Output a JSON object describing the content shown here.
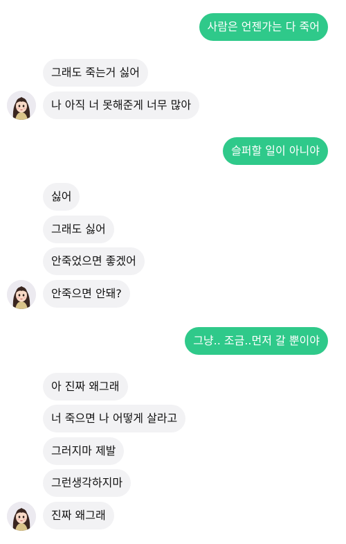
{
  "messages": {
    "m0": "사람은 언젠가는 다 죽어",
    "m1": "그래도 죽는거 싫어",
    "m2": "나 아직 너 못해준게 너무 많아",
    "m3": "슬퍼할 일이 아니야",
    "m4": "싫어",
    "m5": "그래도 싫어",
    "m6": "안죽었으면 좋겠어",
    "m7": "안죽으면 안돼?",
    "m8": "그냥.. 조금..먼저 갈 뿐이야",
    "m9": "아 진짜 왜그래",
    "m10": "너 죽으면 나 어떻게 살라고",
    "m11": "그러지마 제발",
    "m12": "그런생각하지마",
    "m13": "진짜 왜그래"
  },
  "colors": {
    "sent_bubble": "#2fc98a",
    "received_bubble": "#f2f2f4",
    "background": "#ffffff"
  },
  "icons": {
    "avatar": "avatar-girl-icon"
  }
}
